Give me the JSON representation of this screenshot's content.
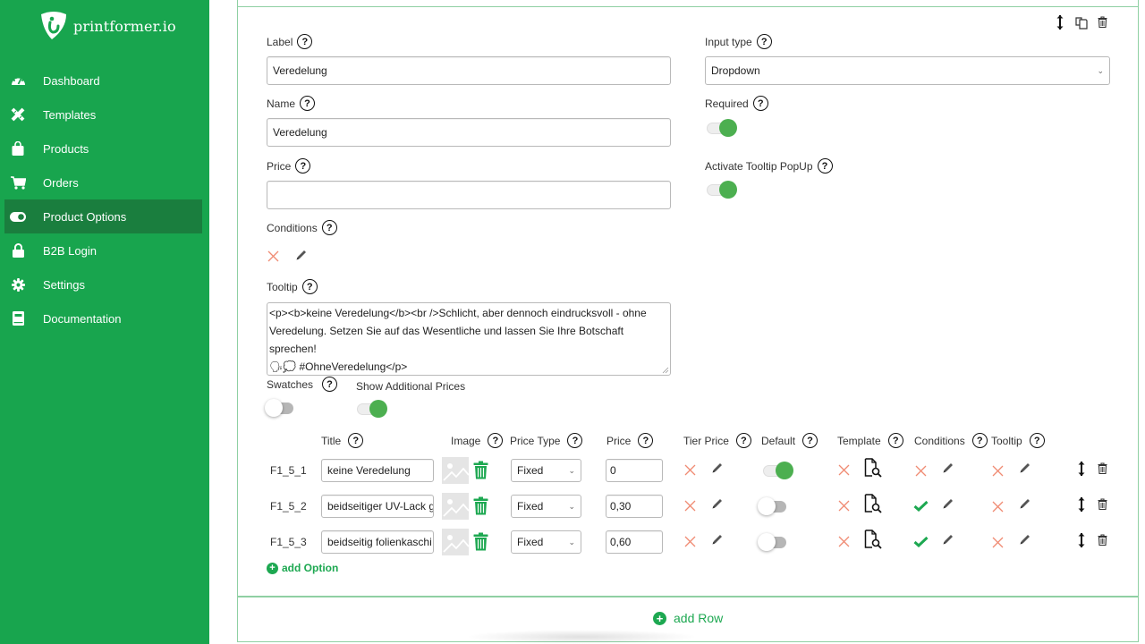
{
  "brand": {
    "name": "printformer.io",
    "color": "#18a54e",
    "active_color": "#1a7e3e"
  },
  "sidebar": {
    "items": [
      {
        "label": "Dashboard",
        "icon": "dashboard-gauge-icon",
        "active": false
      },
      {
        "label": "Templates",
        "icon": "pencil-ruler-icon",
        "active": false
      },
      {
        "label": "Products",
        "icon": "shopping-bag-icon",
        "active": false
      },
      {
        "label": "Orders",
        "icon": "cart-icon",
        "active": false
      },
      {
        "label": "Product Options",
        "icon": "toggle-icon",
        "active": true
      },
      {
        "label": "B2B Login",
        "icon": "lock-icon",
        "active": false
      },
      {
        "label": "Settings",
        "icon": "gear-icon",
        "active": false
      },
      {
        "label": "Documentation",
        "icon": "book-icon",
        "active": false
      }
    ]
  },
  "card_actions": {
    "move": "move-icon",
    "copy": "copy-icon",
    "delete": "trash-icon"
  },
  "form": {
    "label": {
      "title": "Label",
      "value": "Veredelung"
    },
    "name": {
      "title": "Name",
      "value": "Veredelung"
    },
    "price": {
      "title": "Price",
      "value": ""
    },
    "conditions": {
      "title": "Conditions"
    },
    "tooltip": {
      "title": "Tooltip",
      "line1": "<p><b>keine Veredelung</b><br />Schlicht, aber dennoch eindrucksvoll - ohne",
      "line2": "Veredelung. Setzen Sie auf das Wesentliche und lassen Sie Ihre Botschaft sprechen!",
      "line3": "🗣💭 #OhneVeredelung</p>"
    },
    "swatches": {
      "title": "Swatches",
      "on": false
    },
    "show_additional_prices": {
      "title": "Show Additional Prices",
      "on": true
    },
    "input_type": {
      "title": "Input type",
      "value": "Dropdown"
    },
    "required": {
      "title": "Required",
      "on": true
    },
    "activate_tooltip": {
      "title": "Activate Tooltip PopUp",
      "on": true
    }
  },
  "options_table": {
    "headers": {
      "title": "Title",
      "image": "Image",
      "price_type": "Price Type",
      "price": "Price",
      "tier_price": "Tier Price",
      "default": "Default",
      "template": "Template",
      "conditions": "Conditions",
      "tooltip": "Tooltip"
    },
    "rows": [
      {
        "id": "F1_5_1",
        "title": "keine Veredelung",
        "price_type": "Fixed",
        "price": "0",
        "default": true,
        "conditions_set": false
      },
      {
        "id": "F1_5_2",
        "title": "beidseitiger UV-Lack g",
        "price_type": "Fixed",
        "price": "0,30",
        "default": false,
        "conditions_set": true
      },
      {
        "id": "F1_5_3",
        "title": "beidseitig folienkaschi",
        "price_type": "Fixed",
        "price": "0,60",
        "default": false,
        "conditions_set": true
      }
    ],
    "add_option": "add Option"
  },
  "add_row": "add Row",
  "colors": {
    "accent_green": "#1da851",
    "toggle_on": "#4caf50",
    "x_red": "#f08b73",
    "card_border": "#8fd0a3"
  }
}
